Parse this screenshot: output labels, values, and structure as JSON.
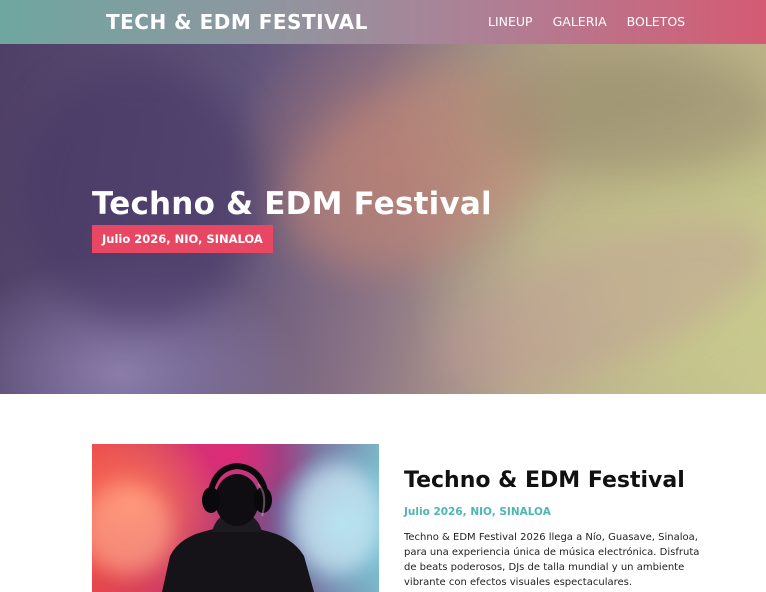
{
  "header": {
    "logo": "TECH & EDM FESTIVAL",
    "nav": [
      {
        "label": "LINEUP"
      },
      {
        "label": "GALERIA"
      },
      {
        "label": "BOLETOS"
      }
    ]
  },
  "hero": {
    "title": "Techno & EDM Festival",
    "badge": "Julio 2026, NIO, SINALOA"
  },
  "about": {
    "title": "Techno & EDM Festival",
    "date": "Julio 2026, NIO, SINALOA",
    "text": "Techno & EDM Festival 2026 llega a Nío, Guasave, Sinaloa, para una experiencia única de música electrónica. Disfruta de beats poderosos, DJs de talla mundial y un ambiente vibrante con efectos visuales espectaculares."
  },
  "colors": {
    "accent": "#e84763",
    "teal": "#4db6b0"
  }
}
